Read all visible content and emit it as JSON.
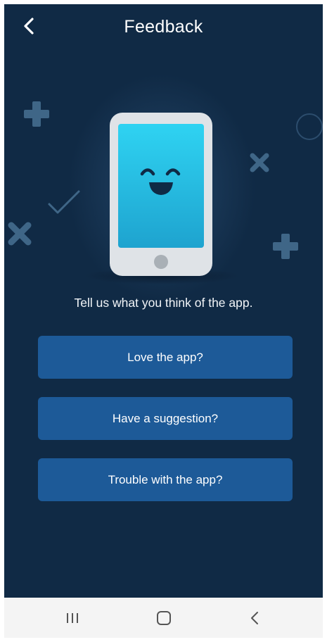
{
  "header": {
    "title": "Feedback",
    "back_icon": "chevron-left-icon"
  },
  "tagline": "Tell us what you think of the app.",
  "options": [
    {
      "label": "Love the app?"
    },
    {
      "label": "Have a suggestion?"
    },
    {
      "label": "Trouble with the app?"
    }
  ],
  "navbar": {
    "recents_icon": "recents-icon",
    "home_icon": "home-icon",
    "back_icon": "back-icon"
  },
  "colors": {
    "background": "#102a45",
    "button": "#1d5a98",
    "phone_screen": "#29b9df",
    "phone_body": "#dfe3e7",
    "decoration": "#3f6687",
    "navbar": "#f4f4f4"
  }
}
